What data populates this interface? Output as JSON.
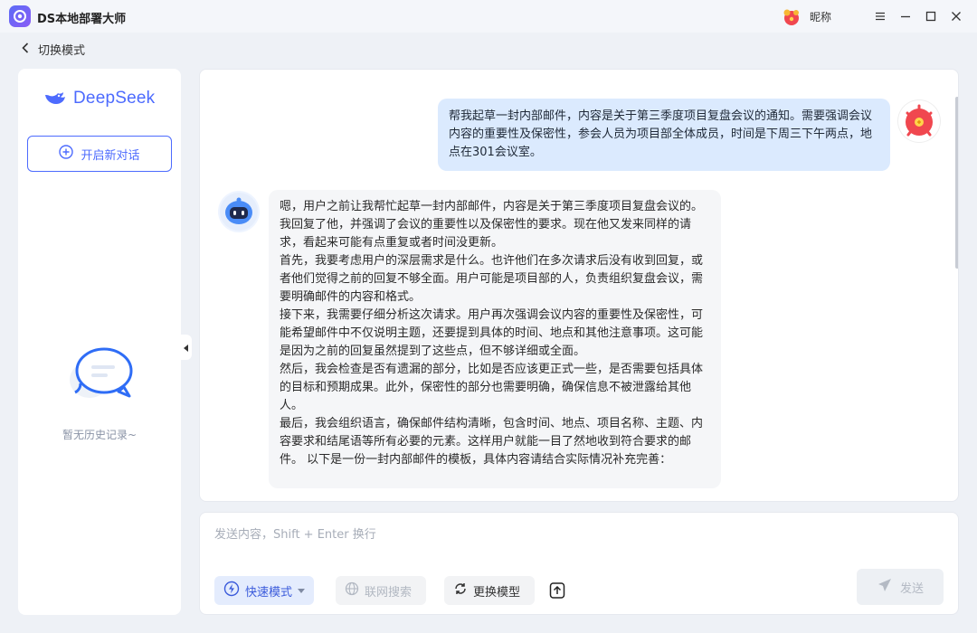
{
  "window": {
    "title": "DS本地部署大师",
    "nickname": "昵称"
  },
  "nav": {
    "back_label": "切换模式"
  },
  "sidebar": {
    "brand": "DeepSeek",
    "new_chat_label": "开启新对话",
    "empty_text": "暂无历史记录~"
  },
  "chat": {
    "user_message": "帮我起草一封内部邮件，内容是关于第三季度项目复盘会议的通知。需要强调会议内容的重要性及保密性，参会人员为项目部全体成员，时间是下周三下午两点，地点在301会议室。",
    "bot_paragraphs": [
      "嗯，用户之前让我帮忙起草一封内部邮件，内容是关于第三季度项目复盘会议的。我回复了他，并强调了会议的重要性以及保密性的要求。现在他又发来同样的请求，看起来可能有点重复或者时间没更新。",
      "首先，我要考虑用户的深层需求是什么。也许他们在多次请求后没有收到回复，或者他们觉得之前的回复不够全面。用户可能是项目部的人，负责组织复盘会议，需要明确邮件的内容和格式。",
      "接下来，我需要仔细分析这次请求。用户再次强调会议内容的重要性及保密性，可能希望邮件中不仅说明主题，还要提到具体的时间、地点和其他注意事项。这可能是因为之前的回复虽然提到了这些点，但不够详细或全面。",
      "然后，我会检查是否有遗漏的部分，比如是否应该更正式一些，是否需要包括具体的目标和预期成果。此外，保密性的部分也需要明确，确保信息不被泄露给其他人。",
      "最后，我会组织语言，确保邮件结构清晰，包含时间、地点、项目名称、主题、内容要求和结尾语等所有必要的元素。这样用户就能一目了然地收到符合要求的邮件。 以下是一份一封内部邮件的模板，具体内容请结合实际情况补充完善："
    ]
  },
  "composer": {
    "placeholder": "发送内容，Shift + Enter 换行",
    "fast_mode_label": "快速模式",
    "web_search_label": "联网搜索",
    "switch_model_label": "更换模型",
    "send_label": "发送"
  },
  "colors": {
    "accent": "#4d6bfe",
    "user_bubble": "#dbeafe",
    "bot_bubble": "#f5f6f8"
  }
}
